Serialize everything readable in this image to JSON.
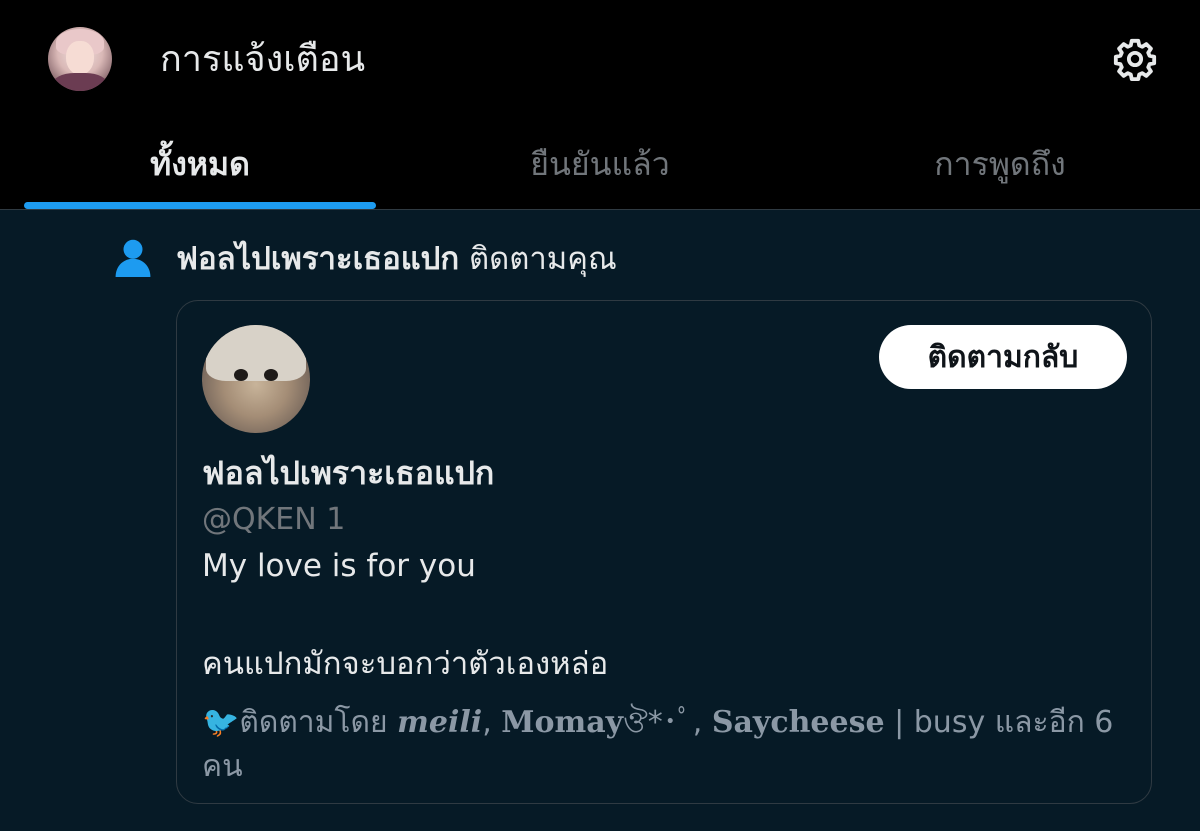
{
  "header": {
    "title": "การแจ้งเตือน",
    "settings_icon": "gear-icon"
  },
  "tabs": [
    {
      "label": "ทั้งหมด",
      "active": true
    },
    {
      "label": "ยืนยันแล้ว",
      "active": false
    },
    {
      "label": "การพูดถึง",
      "active": false
    }
  ],
  "colors": {
    "accent": "#1d9bf0",
    "background": "#061a26",
    "header_background": "#000000"
  },
  "notification": {
    "icon": "person-icon",
    "name": "ฟอลไปเพราะเธอแปก",
    "action": "ติดตามคุณ",
    "card": {
      "display_name": "ฟอลไปเพราะเธอแปก",
      "handle": "@QKEN 1",
      "follow_back_label": "ติดตามกลับ",
      "bio_line1": "My love is for you",
      "bio_line2": "คนแปกมักจะบอกว่าตัวเองหล่อ",
      "followed_by": {
        "bird_icon": "🐦",
        "prefix": "ติดตามโดย",
        "user1": "meili",
        "user2": "Momay",
        "user2_suffix": "ঔ*･ﾟ",
        "user3": "Saycheese",
        "rest": "| busy และอีก 6 คน"
      }
    }
  }
}
